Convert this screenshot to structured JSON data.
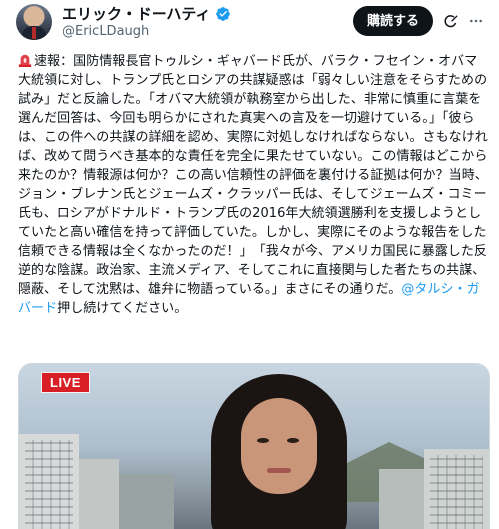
{
  "author": {
    "display_name": "エリック・ドーハティ",
    "handle": "@EricLDaugh",
    "verified": true,
    "avatar_icon": "avatar-photo"
  },
  "actions": {
    "subscribe_label": "購読する",
    "grok_icon": "grok-icon",
    "more_icon": "more-icon"
  },
  "tweet": {
    "lead_icon": "siren-emoji",
    "text": "速報：国防情報長官トゥルシ・ギャバード氏が、バラク・フセイン・オバマ大統領に対し、トランプ氏とロシアの共謀疑惑は「弱々しい注意をそらすための試み」だと反論した。「オバマ大統領が執務室から出した、非常に慎重に言葉を選んだ回答は、今回も明らかにされた真実への言及を一切避けている。」「彼らは、この件への共謀の詳細を認め、実際に対処しなければならない。さもなければ、改めて問うべき基本的な責任を完全に果たせていない。この情報はどこから来たのか？情報源は何か？この高い信頼性の評価を裏付ける証拠は何か？当時、ジョン・ブレナン氏とジェームズ・クラッパー氏は、そしてジェームズ・コミー氏も、ロシアがドナルド・トランプ氏の2016年大統領選勝利を支援しようとしていたと高い確信を持って評価していた。しかし、実際にそのような報告をした信頼できる情報は全くなかったのだ！」　「我々が今、アメリカ国民に暴露した反逆的な陰謀。政治家、主流メディア、そしてこれに直接関与した者たちの共謀、隠蔽、そして沈黙は、雄弁に物語っている。」まさにその通りだ。",
    "mention": "@タルシ・ガバード",
    "mention_suffix": "押し続けてください。"
  },
  "media": {
    "live_badge": "LIVE",
    "accent_color": "#d81f26"
  },
  "colors": {
    "link": "#1d9bf0",
    "secondary_text": "#536471",
    "verified_badge": "#1d9bf0",
    "button_bg": "#0f1419"
  }
}
